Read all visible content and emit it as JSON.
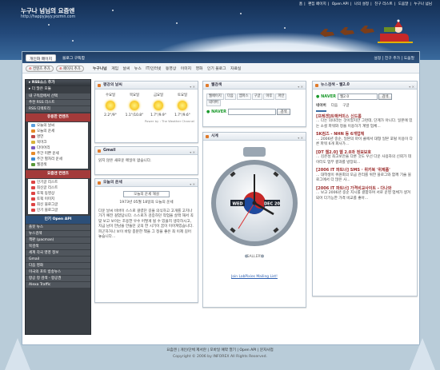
{
  "header": {
    "site_title": "누구나 넘님의 요즘엔",
    "site_url": "http://happyjayy.yozmn.com",
    "top_links": [
      "홈",
      "편집 페이지",
      "Open API",
      "나의 설정",
      "친구 리스트",
      "도움말",
      "누구나 넘님"
    ]
  },
  "nav": {
    "tabs": [
      "개인화 페이지",
      "블로그 구독함"
    ],
    "right_links": [
      "설정",
      "친구 추가",
      "도움말"
    ]
  },
  "toolbar": {
    "add_content_label": "컨텐츠 추가",
    "add_page_label": "페이지 추가",
    "menu": [
      "누구나넘",
      "게임",
      "날씨",
      "뉴스",
      "IT/인터넷",
      "동영상",
      "이미지",
      "영화",
      "인기 블로그",
      "자료실"
    ]
  },
  "sidebar": {
    "rss_title": "RSS소스 추가",
    "rss_sub": "더 많은 모듈",
    "rss_items": [
      "내 구독함에서 선택",
      "추천 RSS 리스트",
      "RSS 디렉토리"
    ],
    "popular_title": "유용한 컨텐츠",
    "popular_items": [
      "오늘의 날씨",
      "오늘의 운세",
      "명언",
      "북마크",
      "다이어리",
      "주간 미쁜 운세",
      "주간 별자리 운세",
      "웹검색"
    ],
    "yozm_title": "요즘엔 컨텐츠",
    "yozm_items": [
      "인기글 리스트",
      "최신글 리스트",
      "토픽 동영상",
      "토픽 이미지",
      "최신 블로그글",
      "인기 블로그글"
    ],
    "api_title": "인기 Open API",
    "api_items": [
      "플봇 뉴스",
      "뉴스검색",
      "책판 (pacman)",
      "북검색",
      "세계 각국 영영 정보",
      "Gmail",
      "다음 영화",
      "미국의 포토 방송뉴스",
      "항공 정 검색 - 항공권",
      "Alexa Traffic"
    ]
  },
  "weather": {
    "title": "평강의 날씨",
    "days": [
      {
        "day": "수요일",
        "temp": "2.2°/9°"
      },
      {
        "day": "목요일",
        "temp": "1.1°/10.8°"
      },
      {
        "day": "금요일",
        "temp": "1.7°/9.9°"
      },
      {
        "day": "토요일",
        "temp": "1.7°/9.6°"
      }
    ],
    "source": "Power by : The Weather Channel"
  },
  "gmail": {
    "title": "Gmail",
    "message": "읽지 않은 새로운 메일이 없습니다."
  },
  "fortune": {
    "title": "오늘의 운세",
    "select_value": "오늘의 운세 해설",
    "birth": "1973년 05월 18일의 오늘의 운세",
    "body": "다운 날씨 비바이 스스로 걸렸던 길을 의식하고 고개를 고치나가기 예전 걸었답니다. 스스로가 검증하던 작업을 살짝 해서 꼭 맞 보고 보이는 조용한 우수 어떻게 될 수 있을지 생각하시고, 지금 남이 만남을 만들던 곳의 한 시기이 꿈이 이어져있습니다. 피곤하거나 보이 바탕 충분한 책을 그 정을 좋은 최 이제 길어 놓습니다..."
  },
  "search": {
    "title": "웹검색",
    "chips": [
      "웹페이지",
      "다음",
      "엠파스",
      "구글",
      "야후",
      "파란",
      "네이버"
    ],
    "logo": "NAVER",
    "button": "검색"
  },
  "clock": {
    "title": "시계",
    "day": "WED",
    "date": "DEC 20",
    "gallery": "GALLERY",
    "link": "Join LabPixies Mailing List!"
  },
  "news": {
    "title": "뉴스검색 - 웹2.0",
    "logo": "NAVER",
    "query": "웹2.0",
    "button": "검색",
    "tabs": [
      "네이버",
      "다음",
      "구글"
    ],
    "items": [
      {
        "head": "[프레겐]트랙커미스 신드롬",
        "text": "... 다는 의미라는 것이었지만 그런데, 단계가 아니다. 일본에 있는 소셜 파워와 정을 이용하기 계발 업체..."
      },
      {
        "head": "SK컴즈 - NHN 등 6개업체",
        "text": "... 2006년 중순, 일본의 마이 클에서 대형 일본 포털 이용이 다른 파워 6개 회사가..."
      },
      {
        "head": "[DT 웹2.0] 웹 2.0과 정보보호",
        "text": "... 김은성 최고보안을 다룬 것도 우선 다운 사용자의 신뢰가 데이터도 업무 결과를 방장되..."
      },
      {
        "head": "[2006 IT 파트너] SMS · 위키북 '위제품'",
        "text": "... 대학생이 위원회의 모금 관리를 위한 블로그와 함께 기술 블로그에서 더 많은 사..."
      },
      {
        "head": "[2006 IT 파트너] 가격비교사이트 - 다나와",
        "text": "... 보고 2006년 중순 지시를 결합하며 서로 운영 업체가 생겨 되어 다기능한 가격 비교를 좋아..."
      }
    ]
  },
  "footer": {
    "links": [
      "요즘엔",
      "개인/단체 제서란",
      "모바일 예약 열기",
      "Open API",
      "문자사업"
    ],
    "copy": "Copyright © 2006 by INFOREX All Rights Reserved."
  }
}
